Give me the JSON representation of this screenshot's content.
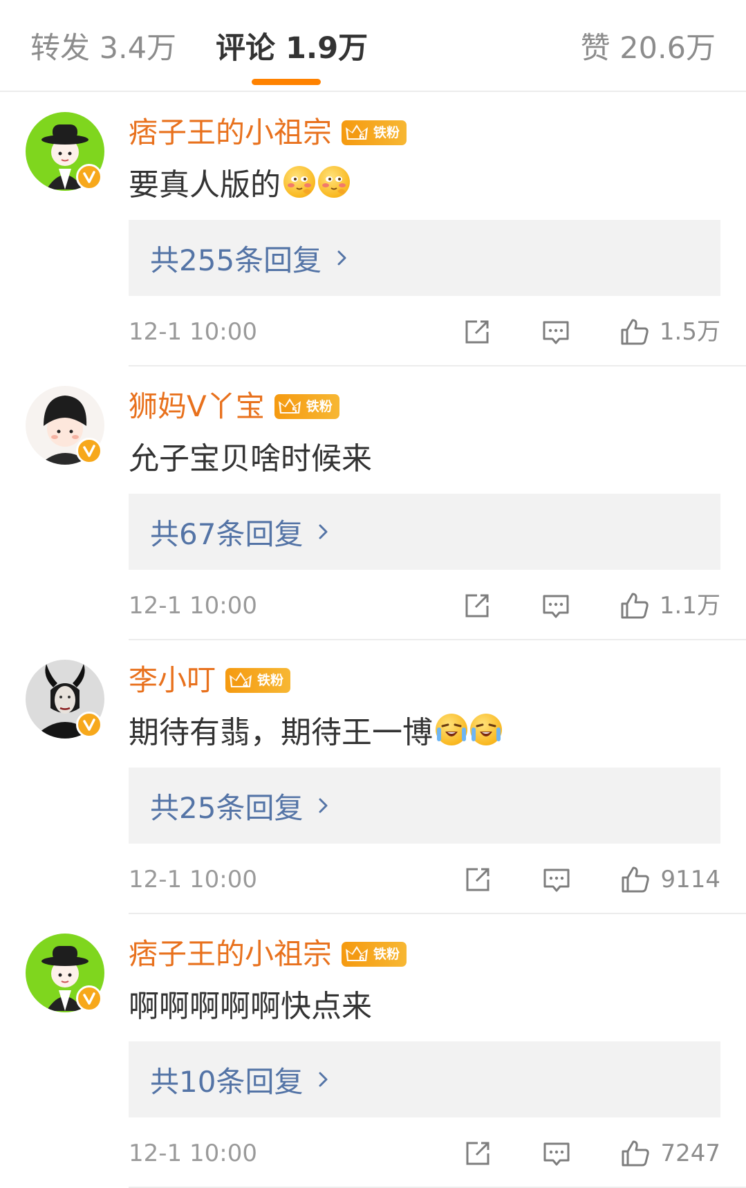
{
  "tabs": [
    {
      "label": "转发 3.4万",
      "active": false
    },
    {
      "label": "评论 1.9万",
      "active": true
    },
    {
      "label": "赞 20.6万",
      "active": false
    }
  ],
  "colors": {
    "accent": "#ff8200",
    "username": "#e8711d",
    "reply_link": "#5474a6",
    "reply_bg": "#f2f2f2",
    "muted": "#9a9a9a",
    "text": "#333333"
  },
  "icons": {
    "share": "share-icon",
    "comment": "comment-icon",
    "like": "thumbs-up-icon",
    "chevron": "chevron-right-icon",
    "verified": "verified-v-icon",
    "fan_crown": "crown-icon"
  },
  "comments": [
    {
      "username": "痞子王的小祖宗",
      "fan_badge": "铁粉",
      "fan_level": "6",
      "text": "要真人版的",
      "emojis": [
        "blush-emoji",
        "blush-emoji"
      ],
      "replies_label": "共255条回复",
      "timestamp": "12-1 10:00",
      "likes": "1.5万"
    },
    {
      "username": "狮妈V丫宝",
      "fan_badge": "铁粉",
      "fan_level": "5",
      "text": "允子宝贝啥时候来",
      "emojis": [],
      "replies_label": "共67条回复",
      "timestamp": "12-1 10:00",
      "likes": "1.1万"
    },
    {
      "username": "李小叮",
      "fan_badge": "铁粉",
      "fan_level": "4",
      "text": "期待有翡，期待王一博",
      "emojis": [
        "laugh-cry-emoji",
        "laugh-cry-emoji"
      ],
      "replies_label": "共25条回复",
      "timestamp": "12-1 10:00",
      "likes": "9114"
    },
    {
      "username": "痞子王的小祖宗",
      "fan_badge": "铁粉",
      "fan_level": "6",
      "text": "啊啊啊啊啊快点来",
      "emojis": [],
      "replies_label": "共10条回复",
      "timestamp": "12-1 10:00",
      "likes": "7247"
    }
  ]
}
